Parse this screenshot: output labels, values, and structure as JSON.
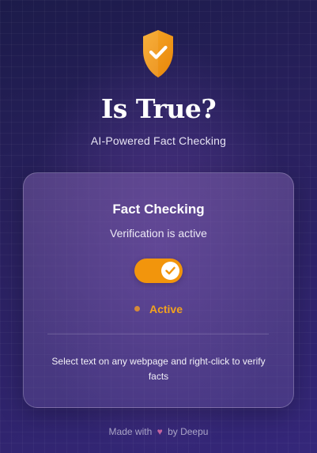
{
  "header": {
    "title": "Is True?",
    "subtitle": "AI-Powered Fact Checking",
    "logo_icon": "shield-check-icon"
  },
  "card": {
    "title": "Fact Checking",
    "subtitle": "Verification is active",
    "toggle": {
      "state": "on",
      "icon": "check-icon"
    },
    "status_label": "Active",
    "hint": "Select text on any webpage and right-click to verify facts"
  },
  "footer": {
    "prefix": "Made with",
    "heart_icon": "heart-icon",
    "suffix": "by Deepu"
  },
  "colors": {
    "accent": "#f2950c",
    "status_text": "#f2a21e",
    "background_start": "#1c1b4a",
    "background_end": "#35277a"
  }
}
